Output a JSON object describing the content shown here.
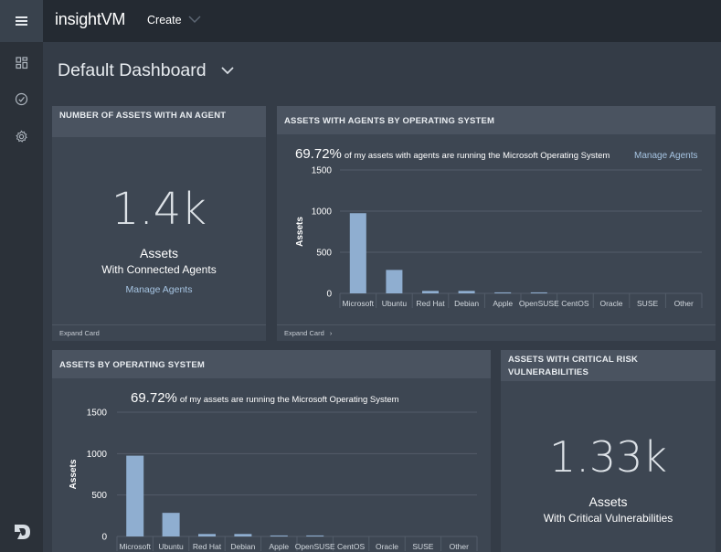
{
  "app": {
    "brand": "insightVM",
    "create_label": "Create",
    "page_title": "Default Dashboard"
  },
  "colors": {
    "bar": "#8faed0",
    "accent_link": "#a6c4e2"
  },
  "icons": {
    "menu": "hamburger-icon",
    "sidebar": [
      "dashboard-icon",
      "check-circle-icon",
      "gear-icon"
    ],
    "logo": "rapid7-logo-icon"
  },
  "cards": {
    "agents_count": {
      "title": "NUMBER OF ASSETS WITH AN AGENT",
      "value": "1.4k",
      "label": "Assets",
      "sublabel": "With Connected Agents",
      "link": "Manage Agents",
      "footer": "Expand Card"
    },
    "agents_os": {
      "title": "ASSETS WITH AGENTS BY OPERATING SYSTEM",
      "stat_value": "69.72%",
      "stat_text": "of my assets with agents are running the Microsoft Operating System",
      "link": "Manage Agents",
      "footer": "Expand Card"
    },
    "assets_os": {
      "title": "ASSETS BY OPERATING SYSTEM",
      "stat_value": "69.72%",
      "stat_text": "of my assets are running the Microsoft Operating System"
    },
    "critical": {
      "title": "ASSETS WITH CRITICAL RISK VULNERABILITIES",
      "value": "1.33k",
      "label": "Assets",
      "sublabel": "With Critical Vulnerabilities"
    }
  },
  "chart_data": [
    {
      "type": "bar",
      "categories": [
        "Microsoft",
        "Ubuntu",
        "Red Hat",
        "Debian",
        "Apple",
        "OpenSUSE",
        "CentOS",
        "Oracle",
        "SUSE",
        "Other"
      ],
      "values": [
        975,
        285,
        30,
        30,
        12,
        12,
        0,
        0,
        0,
        0
      ],
      "ylabel": "Assets",
      "yticks": [
        0,
        500,
        1000,
        1500
      ],
      "ylim": [
        0,
        1500
      ],
      "grid": true
    },
    {
      "type": "bar",
      "categories": [
        "Microsoft",
        "Ubuntu",
        "Red Hat",
        "Debian",
        "Apple",
        "OpenSUSE",
        "CentOS",
        "Oracle",
        "SUSE",
        "Other"
      ],
      "values": [
        975,
        285,
        30,
        30,
        12,
        12,
        0,
        0,
        0,
        0
      ],
      "ylabel": "Assets",
      "yticks": [
        0,
        500,
        1000,
        1500
      ],
      "ylim": [
        0,
        1500
      ],
      "grid": true
    }
  ]
}
